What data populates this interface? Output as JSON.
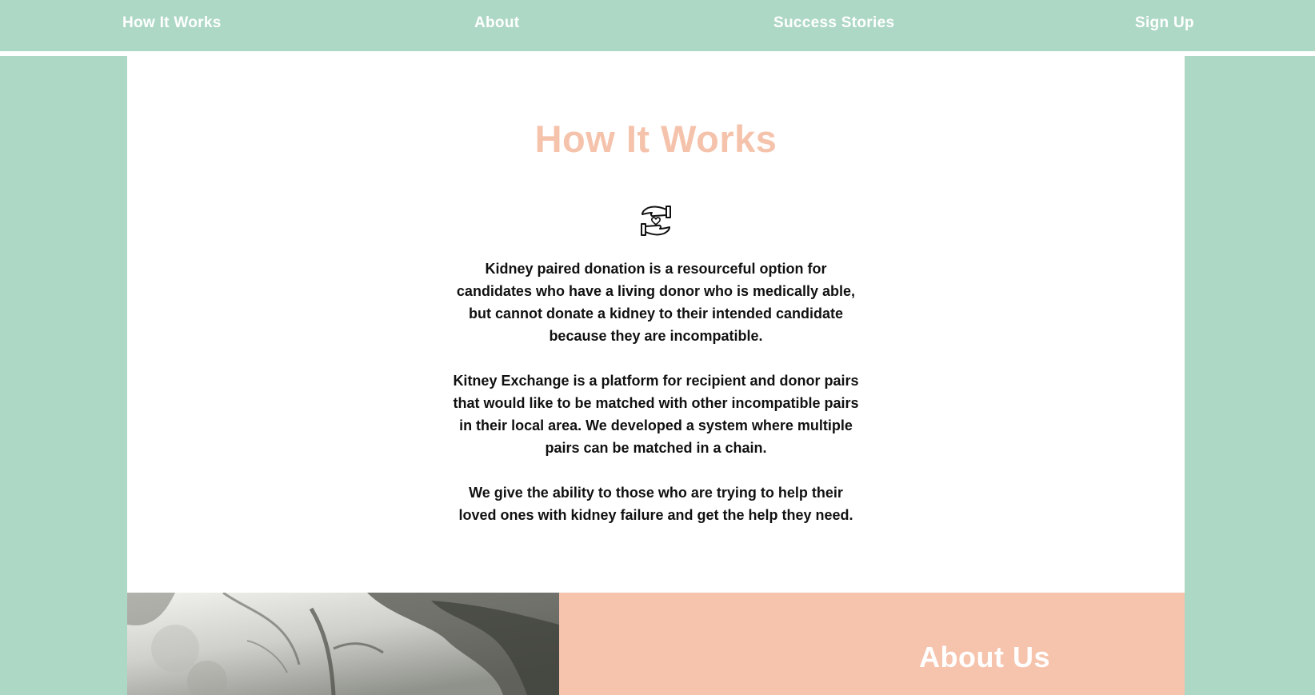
{
  "nav": {
    "how_it_works": "How It Works",
    "about": "About",
    "success_stories": "Success Stories",
    "sign_up": "Sign Up"
  },
  "how_it_works": {
    "title": "How It Works",
    "icon": "hands-heart-icon",
    "paragraphs": [
      "Kidney paired donation is a resourceful option for candidates who have a living donor who is medically able, but cannot donate a kidney to their intended candidate because they are incompatible.",
      "Kitney Exchange is a platform for recipient and donor pairs that would like to be matched with other incompatible pairs in their local area. We developed a system where multiple pairs can be matched in a chain.",
      "We give the ability to those who are trying to help their loved ones with kidney failure and get the help they need."
    ]
  },
  "about": {
    "title": "About Us"
  },
  "colors": {
    "mint": "#aed8c6",
    "peach": "#f6c3ad",
    "white": "#ffffff",
    "text": "#111111"
  }
}
